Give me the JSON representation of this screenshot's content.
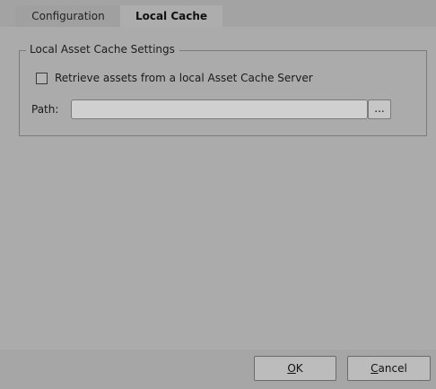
{
  "tabs": [
    {
      "label": "Configuration",
      "selected": false
    },
    {
      "label": "Local Cache",
      "selected": true
    }
  ],
  "group": {
    "title": "Local Asset Cache Settings",
    "checkbox": {
      "label": "Retrieve assets from a local Asset Cache Server",
      "checked": false
    },
    "path": {
      "label": "Path:",
      "value": "",
      "browse_label": "..."
    }
  },
  "buttons": {
    "ok": {
      "mnemonic": "O",
      "rest": "K"
    },
    "cancel": {
      "mnemonic": "C",
      "rest": "ancel"
    }
  }
}
